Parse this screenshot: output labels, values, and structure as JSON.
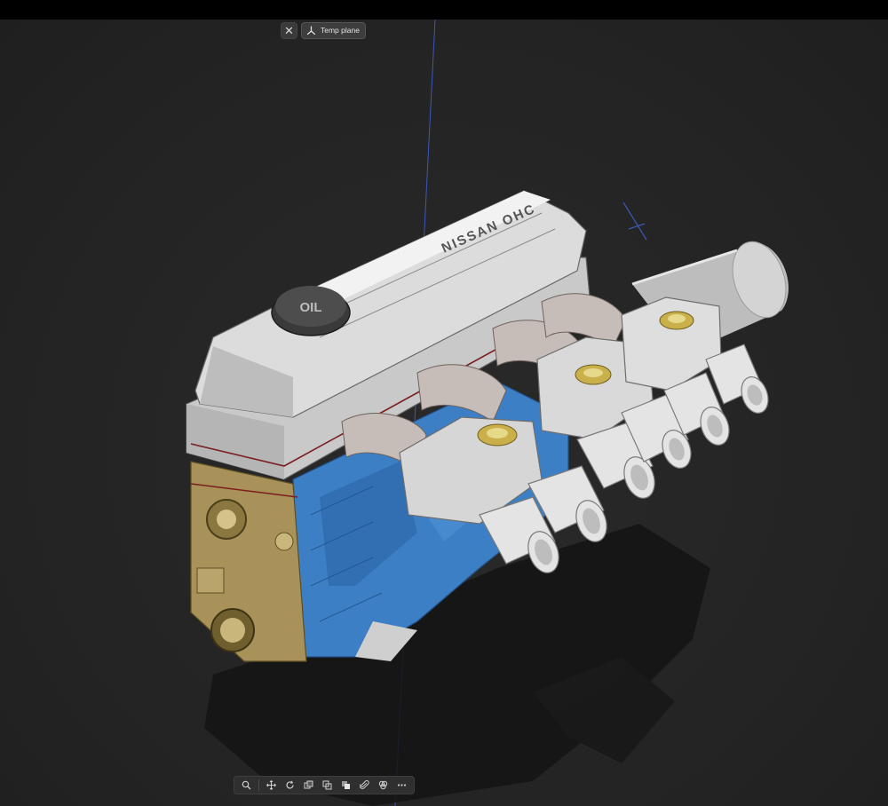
{
  "window": {
    "top_strip_color": "#000000",
    "viewport_bg": "#262626"
  },
  "top_controls": {
    "close_glyph": "✕",
    "close_icon": "close-icon",
    "plane_icon": "axes-icon",
    "plane_label": "Temp plane"
  },
  "model": {
    "subject": "inline six engine with triple carburetors",
    "valve_cover_text": "NISSAN OHC",
    "oil_cap_text": "OIL",
    "colors": {
      "block": "#3d7fc4",
      "valve_cover": "#d9d9d9",
      "timing_cover": "#b19a5e",
      "intake_runners": "#c7bdb8",
      "carburetor": "#dcdcdc",
      "cap_gold": "#c9b04a",
      "axis_line": "#3b58b8"
    }
  },
  "bottom_toolbar": {
    "tools": [
      {
        "name": "zoom-tool",
        "icon": "magnifier-icon"
      },
      {
        "name": "pan-tool",
        "icon": "move-arrows-icon"
      },
      {
        "name": "orbit-tool",
        "icon": "rotate-icon"
      },
      {
        "name": "section-tool",
        "icon": "section-box-icon"
      },
      {
        "name": "copy-tool",
        "icon": "duplicate-icon"
      },
      {
        "name": "view-style-tool",
        "icon": "stack-squares-icon"
      },
      {
        "name": "attach-tool",
        "icon": "paperclip-icon"
      },
      {
        "name": "appearance-tool",
        "icon": "color-circles-icon"
      },
      {
        "name": "more-tool",
        "icon": "ellipsis-icon"
      }
    ]
  }
}
